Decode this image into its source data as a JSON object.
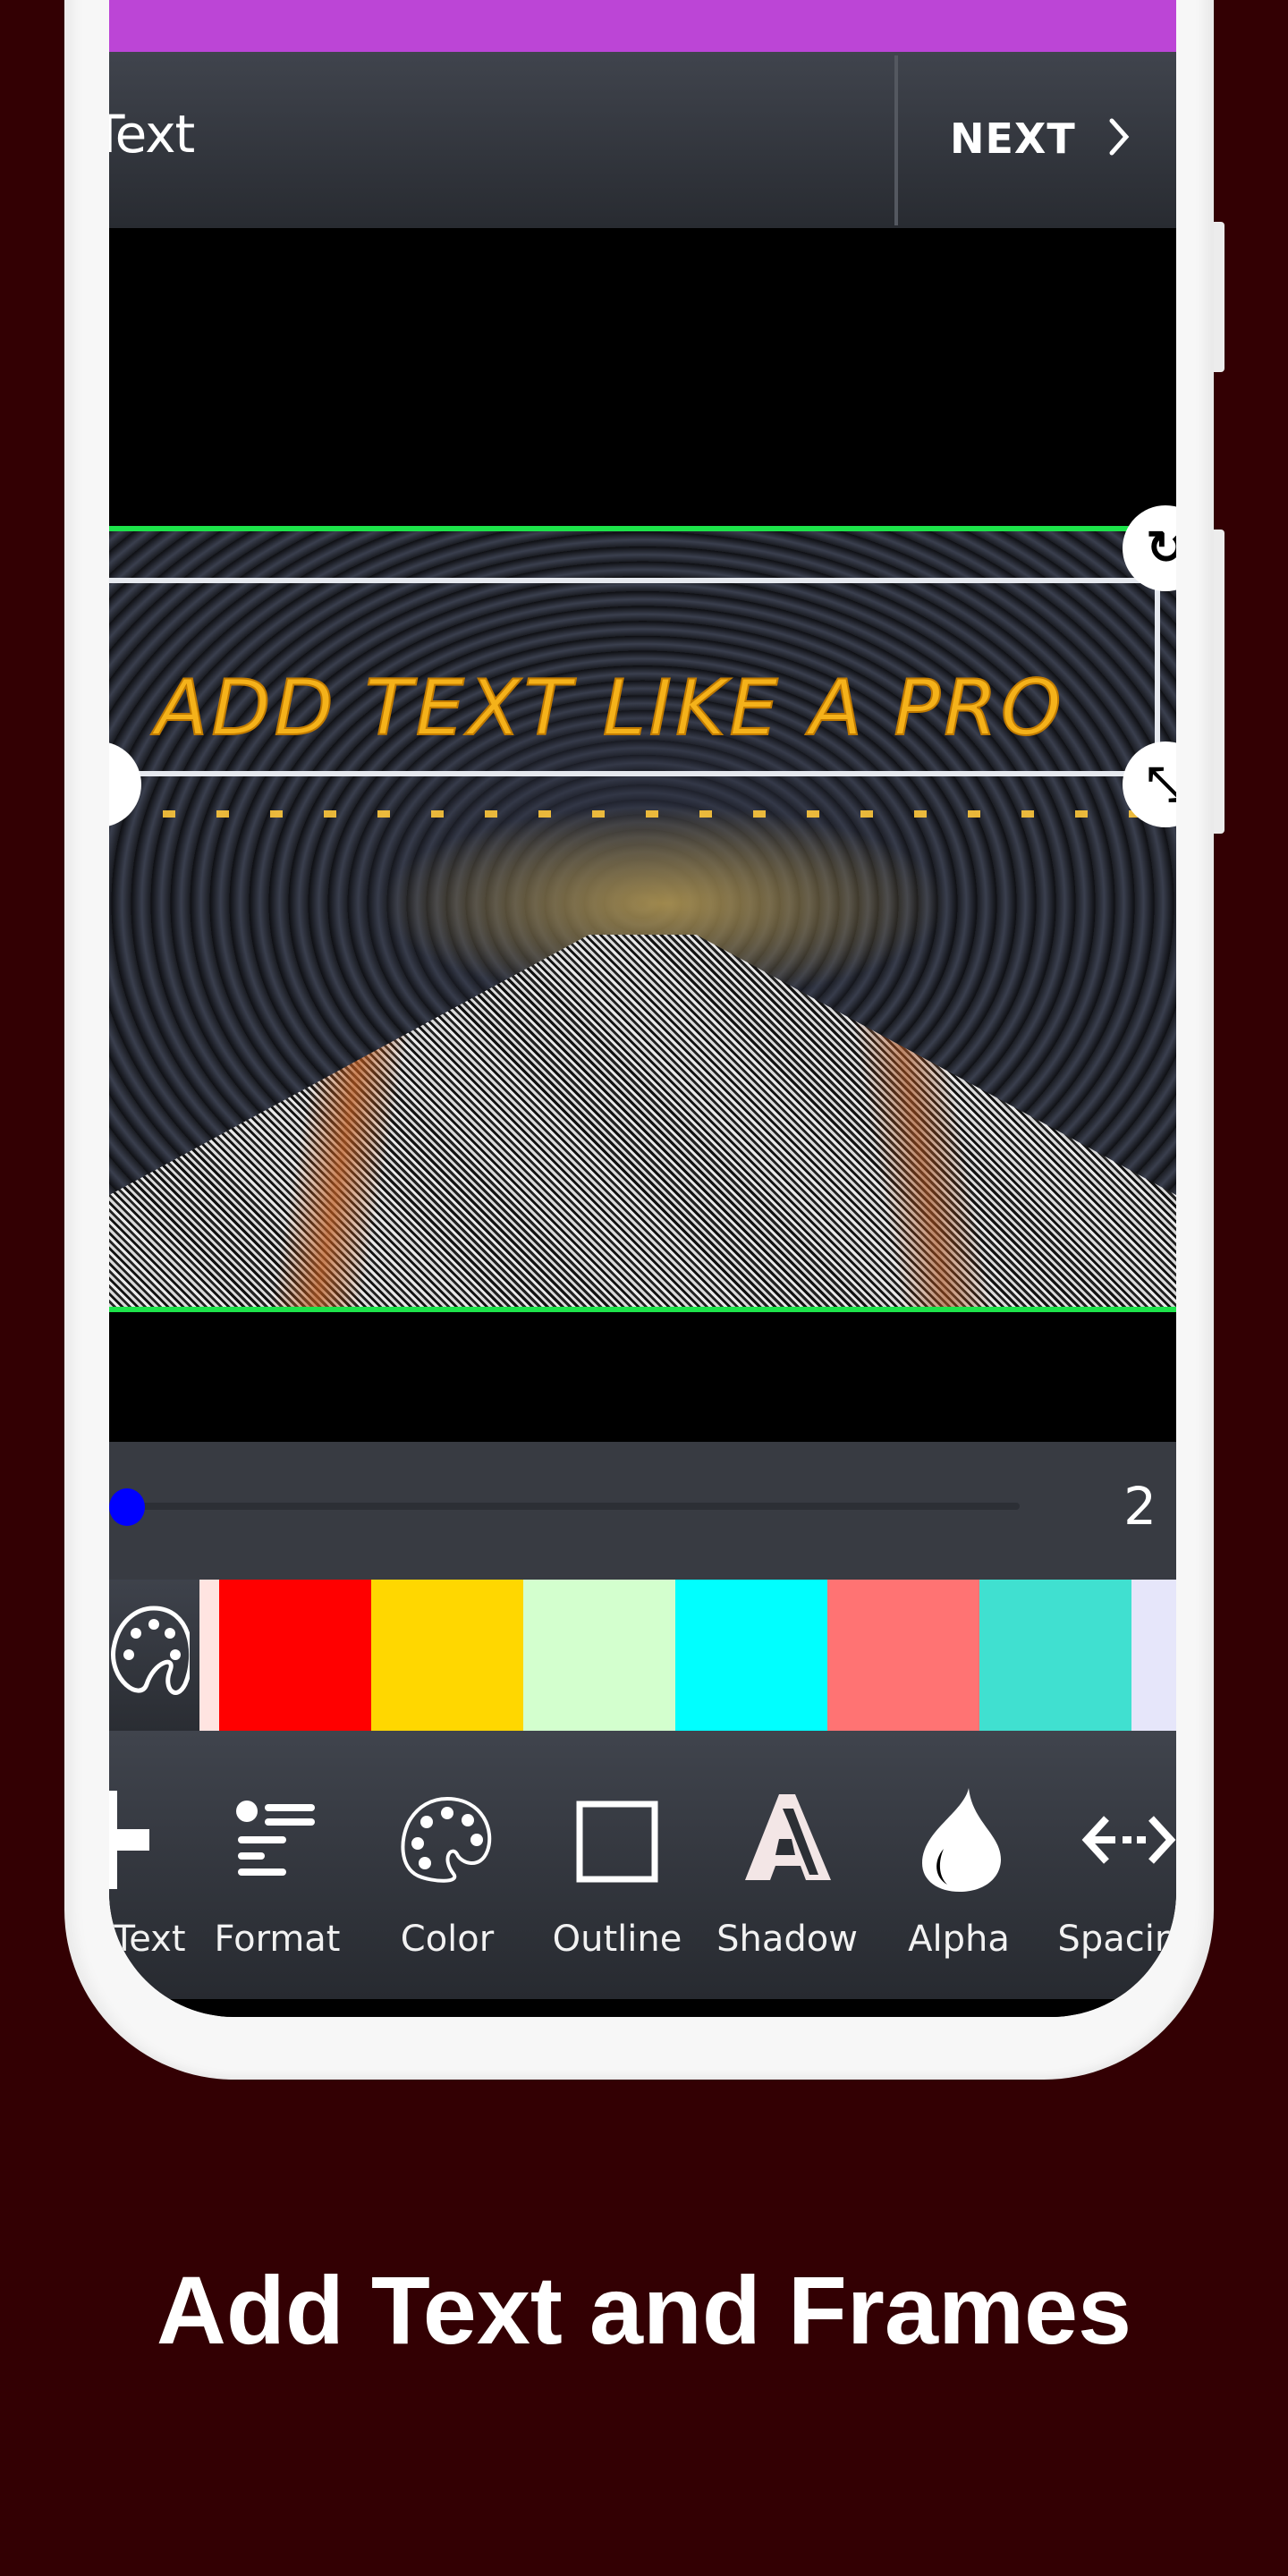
{
  "header": {
    "title": "Text",
    "next_label": "NEXT",
    "next_icon": "chevron-right-icon"
  },
  "canvas": {
    "overlay_text": "ADD TEXT LIKE A PRO",
    "overlay_text_color": "#f5b21a",
    "selection_border_color": "#1de34a",
    "handles": [
      "rotate-handle",
      "resize-handle",
      "move-handle"
    ]
  },
  "slider": {
    "value": "2",
    "fraction": 0.0,
    "knob_color": "#0000ff"
  },
  "colors": {
    "palette_icon": "palette-icon",
    "swatches": [
      "#ffe4e1",
      "#ff0000",
      "#ffd700",
      "#d3ffce",
      "#00ffff",
      "#ff7373",
      "#40e0d0",
      "#e6e6fa"
    ]
  },
  "toolbar": {
    "items": [
      {
        "label": "Add Text",
        "icon": "plus-icon"
      },
      {
        "label": "Format",
        "icon": "format-list-icon"
      },
      {
        "label": "Color",
        "icon": "palette-icon"
      },
      {
        "label": "Outline",
        "icon": "square-outline-icon"
      },
      {
        "label": "Shadow",
        "icon": "letter-a-shadow-icon"
      },
      {
        "label": "Alpha",
        "icon": "drop-icon"
      },
      {
        "label": "Spacing",
        "icon": "arrows-horizontal-icon"
      }
    ]
  },
  "theme": {
    "accent_purple": "#bc45d6",
    "background": "#330003",
    "panel": "#383b42"
  },
  "caption": "Add Text and Frames"
}
